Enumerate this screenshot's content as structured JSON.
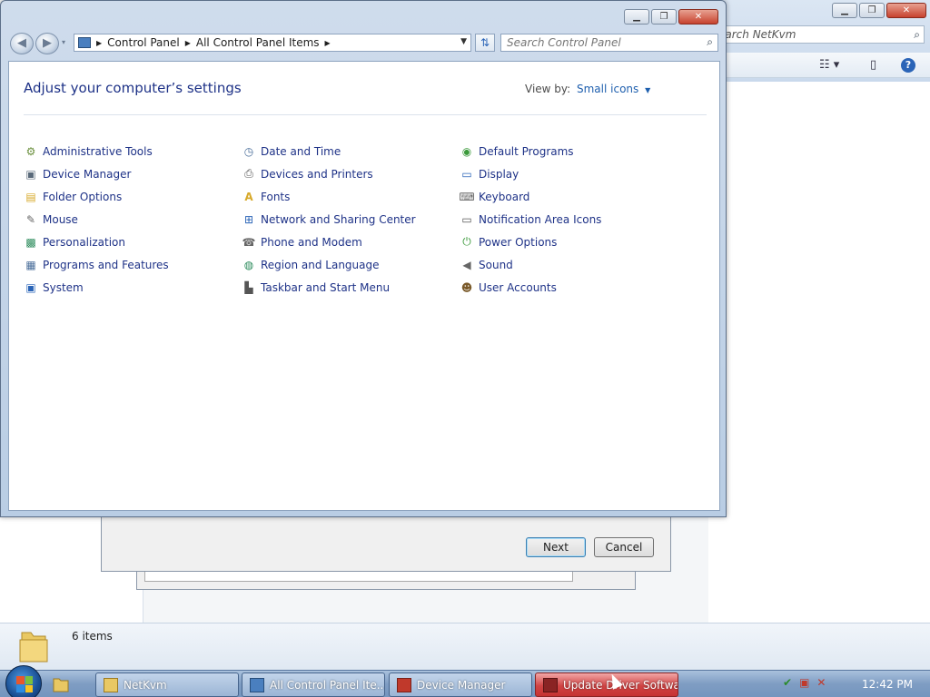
{
  "background_explorer": {
    "search_placeholder": "earch NetKvm",
    "status_count": "6 items"
  },
  "wizard": {
    "next_label": "Next",
    "cancel_label": "Cancel"
  },
  "control_panel": {
    "breadcrumb": [
      "Control Panel",
      "All Control Panel Items"
    ],
    "search_placeholder": "Search Control Panel",
    "heading": "Adjust your computer’s settings",
    "view_by_label": "View by:",
    "view_by_value": "Small icons",
    "items": [
      {
        "label": "Administrative Tools",
        "icon": "admin-tools-icon"
      },
      {
        "label": "Date and Time",
        "icon": "clock-icon"
      },
      {
        "label": "Default Programs",
        "icon": "default-programs-icon"
      },
      {
        "label": "Device Manager",
        "icon": "device-manager-icon"
      },
      {
        "label": "Devices and Printers",
        "icon": "printer-icon"
      },
      {
        "label": "Display",
        "icon": "monitor-icon"
      },
      {
        "label": "Folder Options",
        "icon": "folder-options-icon"
      },
      {
        "label": "Fonts",
        "icon": "fonts-icon"
      },
      {
        "label": "Keyboard",
        "icon": "keyboard-icon"
      },
      {
        "label": "Mouse",
        "icon": "mouse-icon"
      },
      {
        "label": "Network and Sharing Center",
        "icon": "network-icon"
      },
      {
        "label": "Notification Area Icons",
        "icon": "notification-icon"
      },
      {
        "label": "Personalization",
        "icon": "personalization-icon"
      },
      {
        "label": "Phone and Modem",
        "icon": "phone-icon"
      },
      {
        "label": "Power Options",
        "icon": "power-icon"
      },
      {
        "label": "Programs and Features",
        "icon": "programs-icon"
      },
      {
        "label": "Region and Language",
        "icon": "globe-icon"
      },
      {
        "label": "Sound",
        "icon": "speaker-icon"
      },
      {
        "label": "System",
        "icon": "system-icon"
      },
      {
        "label": "Taskbar and Start Menu",
        "icon": "taskbar-icon"
      },
      {
        "label": "User Accounts",
        "icon": "users-icon"
      }
    ]
  },
  "taskbar": {
    "tasks": [
      {
        "label": "NetKvm"
      },
      {
        "label": "All Control Panel Ite..."
      },
      {
        "label": "Device Manager"
      },
      {
        "label": "Update Driver Softwa..."
      }
    ],
    "clock": "12:42 PM"
  },
  "colors": {
    "link_blue": "#1e3287",
    "heading_blue": "#1e3287",
    "active_task": "#d04444"
  }
}
